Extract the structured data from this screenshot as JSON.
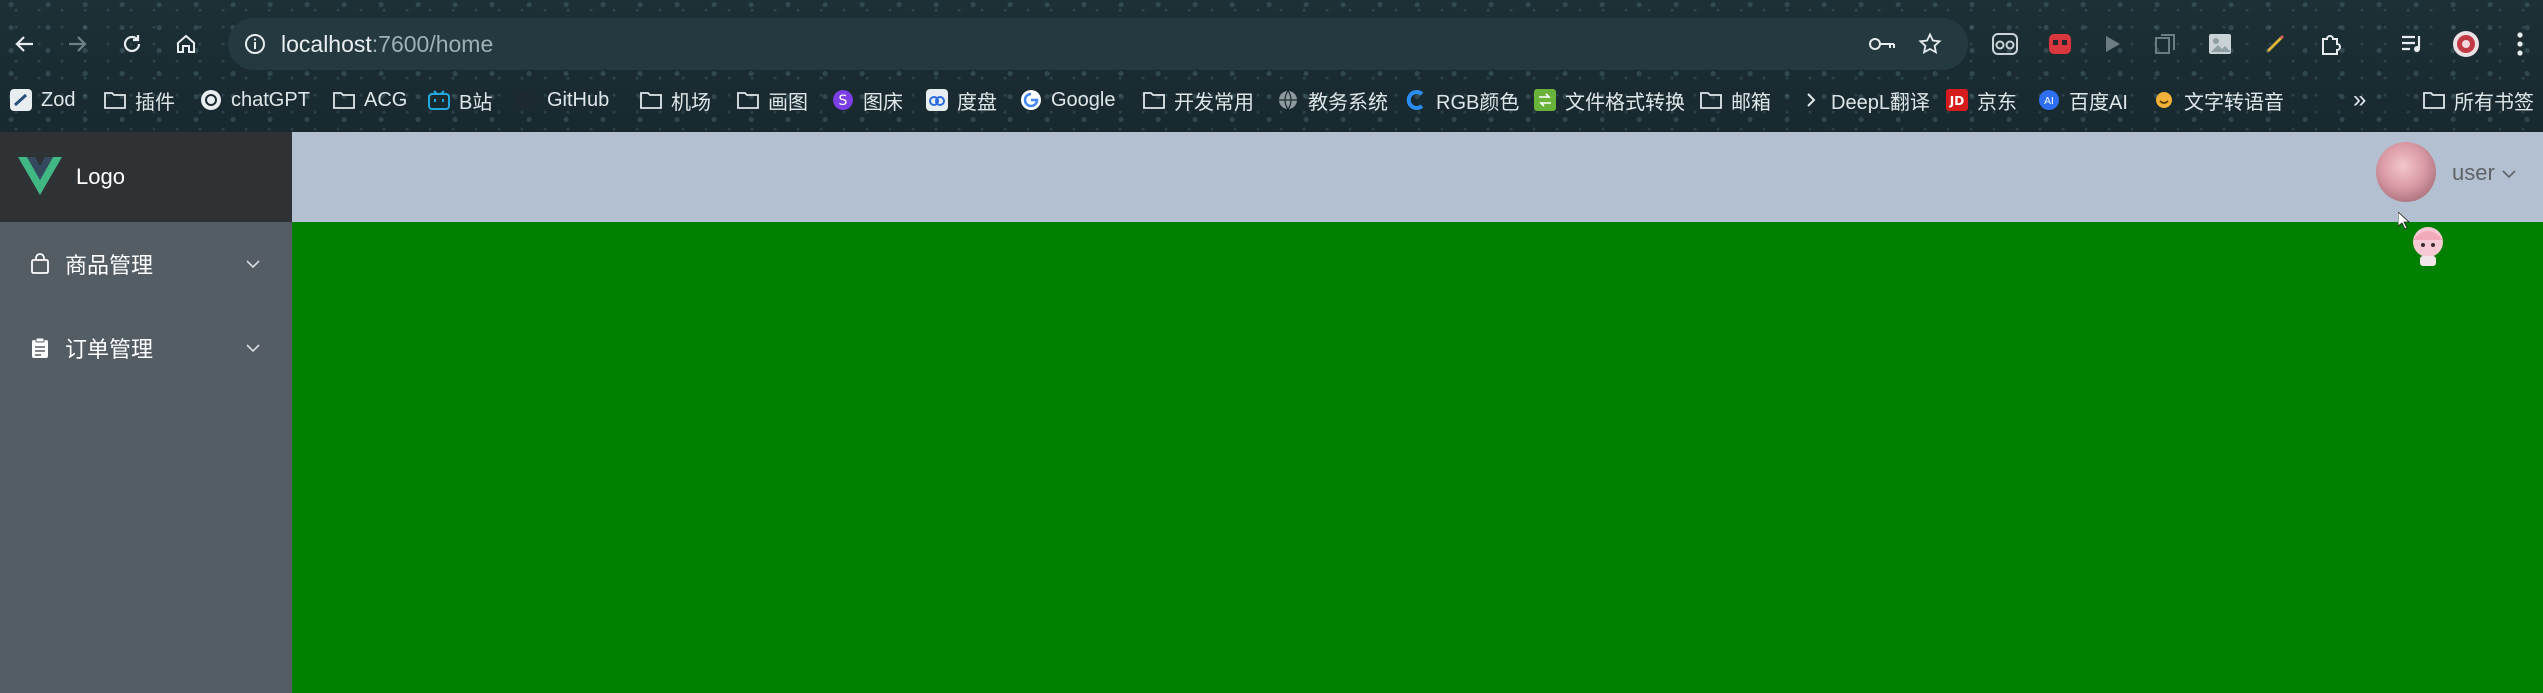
{
  "browser": {
    "url_host": "localhost",
    "url_path": ":7600/home",
    "bookmarks": [
      {
        "label": "Zod",
        "icon": "zod-icon"
      },
      {
        "label": "插件",
        "icon": "folder-icon"
      },
      {
        "label": "chatGPT",
        "icon": "openai-icon"
      },
      {
        "label": "ACG",
        "icon": "folder-icon"
      },
      {
        "label": "B站",
        "icon": "bilibili-icon"
      },
      {
        "label": "GitHub",
        "icon": "github-icon"
      },
      {
        "label": "机场",
        "icon": "folder-icon"
      },
      {
        "label": "画图",
        "icon": "folder-icon"
      },
      {
        "label": "图床",
        "icon": "image-host-icon"
      },
      {
        "label": "度盘",
        "icon": "baidu-pan-icon"
      },
      {
        "label": "Google",
        "icon": "google-icon"
      },
      {
        "label": "开发常用",
        "icon": "folder-icon"
      },
      {
        "label": "教务系统",
        "icon": "globe-icon"
      },
      {
        "label": "RGB颜色",
        "icon": "rgb-icon"
      },
      {
        "label": "文件格式转换",
        "icon": "convert-icon"
      },
      {
        "label": "邮箱",
        "icon": "folder-icon"
      },
      {
        "label": "DeepL翻译",
        "icon": "deepl-icon"
      },
      {
        "label": "京东",
        "icon": "jd-icon"
      },
      {
        "label": "百度AI",
        "icon": "baidu-ai-icon"
      },
      {
        "label": "文字转语音",
        "icon": "tts-icon"
      }
    ],
    "more_label": "»",
    "all_bookmarks": "所有书签"
  },
  "app": {
    "logo_text": "Logo",
    "menu": [
      {
        "label": "商品管理",
        "icon": "bag-icon"
      },
      {
        "label": "订单管理",
        "icon": "clipboard-icon"
      }
    ],
    "user_name": "user"
  },
  "colors": {
    "sidebar_bg": "#545c64",
    "logo_bar_bg": "#2f3235",
    "header_bg": "#b3c0d1",
    "main_bg": "#008000",
    "vue_green": "#41b883",
    "vue_dark": "#35495e"
  }
}
